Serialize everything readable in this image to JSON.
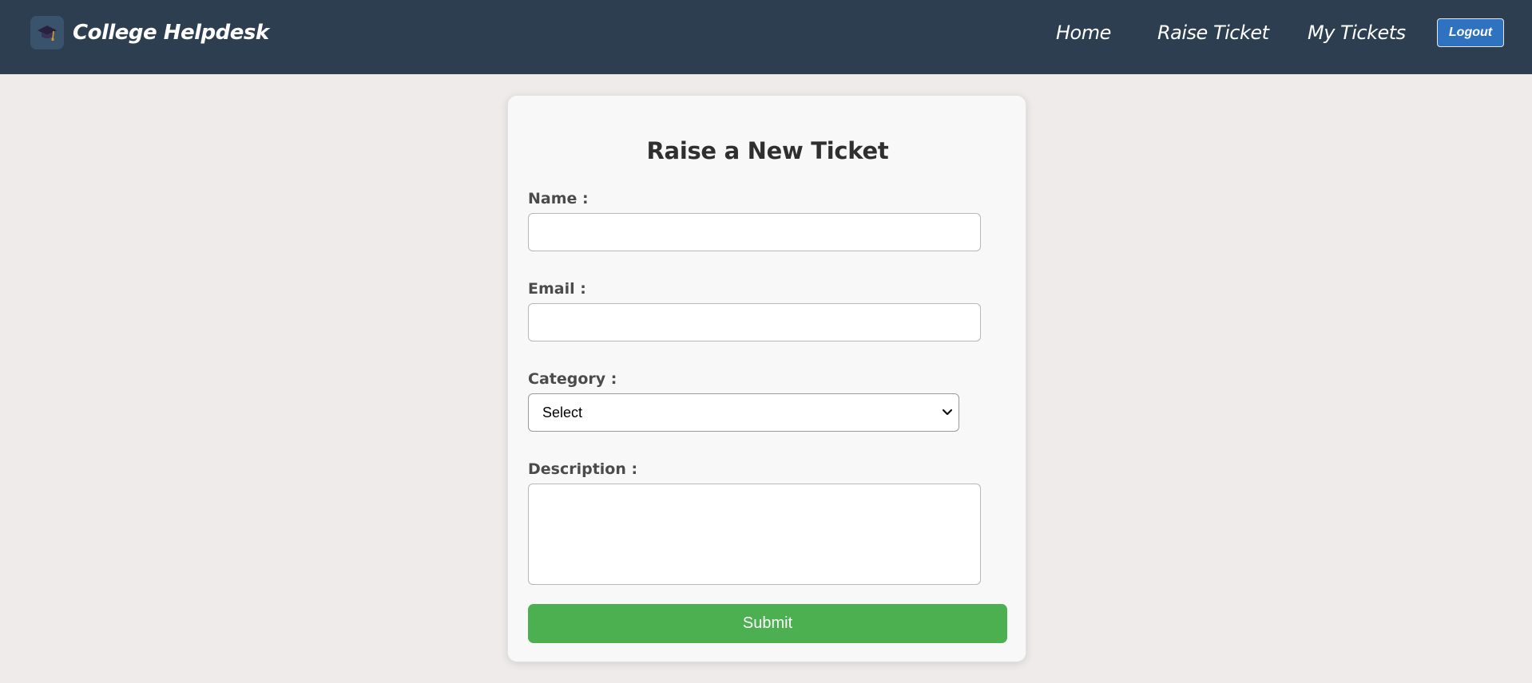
{
  "header": {
    "brand": "College Helpdesk",
    "brand_icon": "graduation-cap-icon",
    "nav": {
      "home": "Home",
      "raise_ticket": "Raise Ticket",
      "my_tickets": "My Tickets"
    },
    "logout_label": "Logout"
  },
  "form": {
    "title": "Raise a New Ticket",
    "name_label": "Name :",
    "name_value": "",
    "email_label": "Email :",
    "email_value": "",
    "category_label": "Category :",
    "category_selected": "Select",
    "description_label": "Description :",
    "description_value": "",
    "submit_label": "Submit"
  },
  "colors": {
    "navbar": "#2c3e50",
    "background": "#efebea",
    "submit": "#4caf50",
    "logout": "#2f73c0"
  }
}
